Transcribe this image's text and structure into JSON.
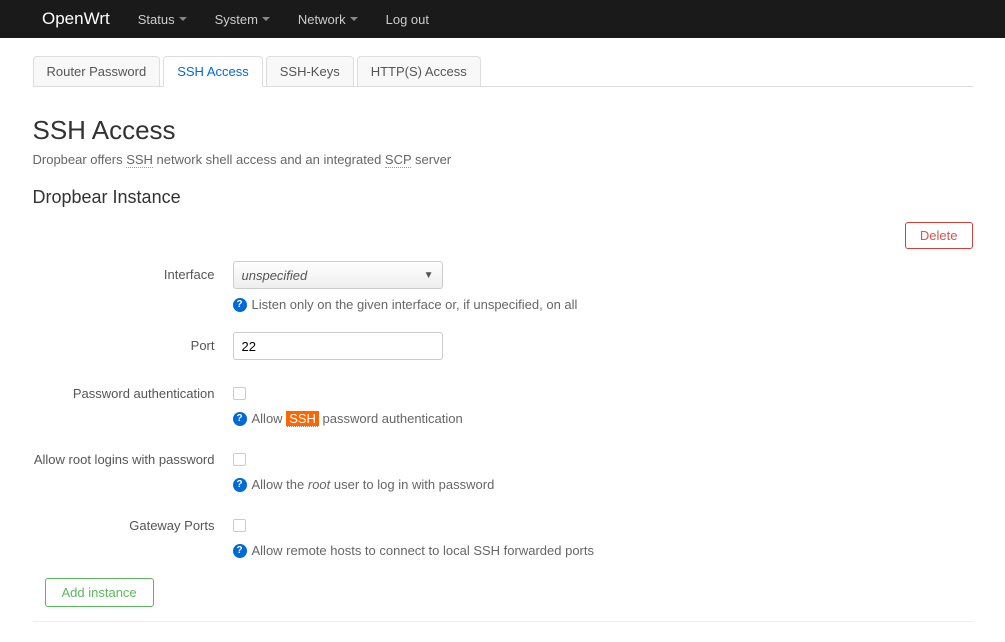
{
  "navbar": {
    "brand": "OpenWrt",
    "items": [
      {
        "label": "Status",
        "dropdown": true
      },
      {
        "label": "System",
        "dropdown": true
      },
      {
        "label": "Network",
        "dropdown": true
      },
      {
        "label": "Log out",
        "dropdown": false
      }
    ]
  },
  "tabs": [
    {
      "label": "Router Password",
      "active": false
    },
    {
      "label": "SSH Access",
      "active": true
    },
    {
      "label": "SSH-Keys",
      "active": false
    },
    {
      "label": "HTTP(S) Access",
      "active": false
    }
  ],
  "page": {
    "title": "SSH Access",
    "desc_pre": "Dropbear offers ",
    "desc_abbr1": "SSH",
    "desc_mid": " network shell access and an integrated ",
    "desc_abbr2": "SCP",
    "desc_post": " server"
  },
  "section": {
    "title": "Dropbear Instance",
    "delete_label": "Delete",
    "add_label": "Add instance"
  },
  "fields": {
    "interface": {
      "label": "Interface",
      "value": "unspecified",
      "hint": "Listen only on the given interface or, if unspecified, on all"
    },
    "port": {
      "label": "Port",
      "value": "22"
    },
    "password_auth": {
      "label": "Password authentication",
      "hint_pre": "Allow ",
      "hint_abbr": "SSH",
      "hint_post": " password authentication"
    },
    "root_login": {
      "label": "Allow root logins with password",
      "hint_pre": "Allow the ",
      "hint_em": "root",
      "hint_post": " user to log in with password"
    },
    "gateway_ports": {
      "label": "Gateway Ports",
      "hint": "Allow remote hosts to connect to local SSH forwarded ports"
    }
  }
}
